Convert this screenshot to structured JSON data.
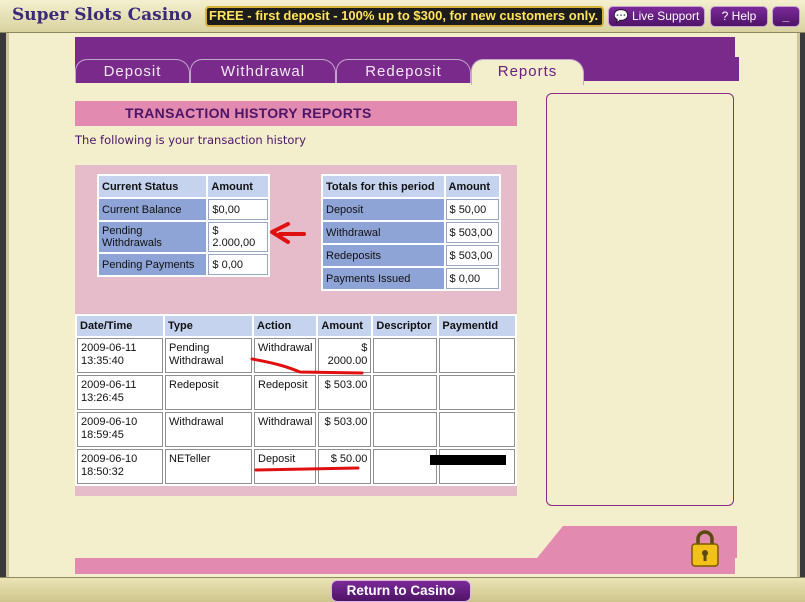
{
  "app": {
    "title": "Super Slots Casino",
    "marquee": "FREE - first deposit - 100% up to $300, for new customers only.",
    "live_support": "Live Support",
    "help": "? Help",
    "minimize": "_"
  },
  "tabs": [
    {
      "label": "Deposit"
    },
    {
      "label": "Withdrawal"
    },
    {
      "label": "Redeposit"
    },
    {
      "label": "Reports",
      "active": true
    }
  ],
  "report": {
    "header": "TRANSACTION HISTORY REPORTS",
    "subtitle": "The following is your transaction history"
  },
  "status_table": {
    "headers": [
      "Current Status",
      "Amount"
    ],
    "rows": [
      {
        "label": "Current Balance",
        "value": "$0,00"
      },
      {
        "label": "Pending Withdrawals",
        "value": "$ 2.000,00"
      },
      {
        "label": "Pending Payments",
        "value": "$ 0,00"
      }
    ]
  },
  "totals_table": {
    "headers": [
      "Totals for this period",
      "Amount"
    ],
    "rows": [
      {
        "label": "Deposit",
        "value": "$ 50,00"
      },
      {
        "label": "Withdrawal",
        "value": "$ 503,00"
      },
      {
        "label": "Redeposits",
        "value": "$ 503,00"
      },
      {
        "label": "Payments Issued",
        "value": "$ 0,00"
      }
    ]
  },
  "transactions": {
    "headers": [
      "Date/Time",
      "Type",
      "Action",
      "Amount",
      "Descriptor",
      "PaymentId"
    ],
    "rows": [
      {
        "date": "2009-06-11",
        "time": "13:35:40",
        "type1": "Pending",
        "type2": "Withdrawal",
        "action": "Withdrawal",
        "amount1": "$",
        "amount2": "2000.00",
        "descriptor": "",
        "payment_id": ""
      },
      {
        "date": "2009-06-11",
        "time": "13:26:45",
        "type1": "Redeposit",
        "type2": "",
        "action": "Redeposit",
        "amount1": "$ 503.00",
        "amount2": "",
        "descriptor": "",
        "payment_id": ""
      },
      {
        "date": "2009-06-10",
        "time": "18:59:45",
        "type1": "Withdrawal",
        "type2": "",
        "action": "Withdrawal",
        "amount1": "$ 503.00",
        "amount2": "",
        "descriptor": "",
        "payment_id": ""
      },
      {
        "date": "2009-06-10",
        "time": "18:50:32",
        "type1": "NETeller",
        "type2": "",
        "action": "Deposit",
        "amount1": "$ 50.00",
        "amount2": "",
        "descriptor": "",
        "payment_id": ""
      }
    ]
  },
  "footer": {
    "return_button": "Return to Casino"
  },
  "colors": {
    "accent_purple": "#7a2a8a",
    "pink": "#e28aaf",
    "annotation_red": "#e01010"
  }
}
